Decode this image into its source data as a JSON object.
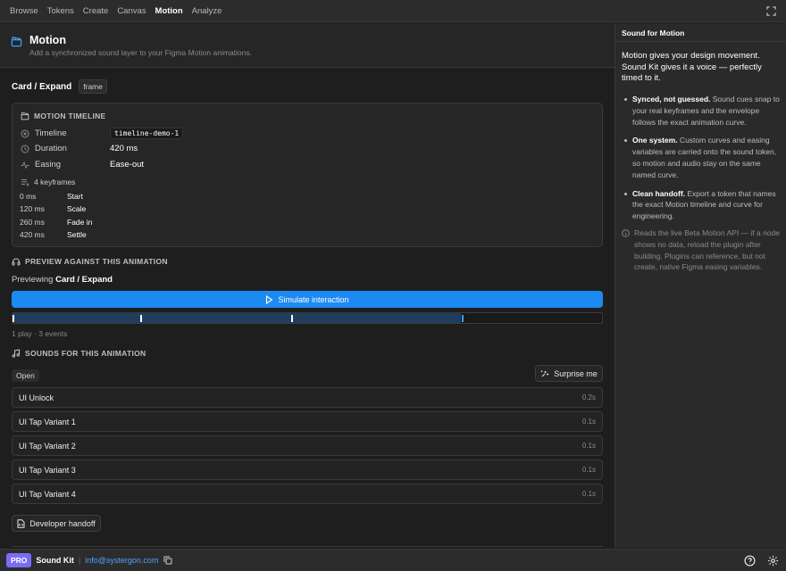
{
  "nav": {
    "tabs": [
      "Browse",
      "Tokens",
      "Create",
      "Canvas",
      "Motion",
      "Analyze"
    ],
    "active": "Motion"
  },
  "header": {
    "title": "Motion",
    "subtitle": "Add a synchronized sound layer to your Figma Motion animations."
  },
  "frame": {
    "name": "Card / Expand",
    "badge": "frame"
  },
  "timeline": {
    "section_title": "MOTION TIMELINE",
    "timeline_label": "Timeline",
    "timeline_value": "timeline-demo-1",
    "duration_label": "Duration",
    "duration_value": "420 ms",
    "easing_label": "Easing",
    "easing_value": "Ease-out",
    "keyframes_label": "4 keyframes",
    "keyframes": [
      {
        "time": "0 ms",
        "name": "Start"
      },
      {
        "time": "120 ms",
        "name": "Scale"
      },
      {
        "time": "260 ms",
        "name": "Fade in"
      },
      {
        "time": "420 ms",
        "name": "Settle"
      }
    ]
  },
  "preview": {
    "section_title": "PREVIEW AGAINST THIS ANIMATION",
    "previewing_prefix": "Previewing",
    "previewing_target": "Card / Expand",
    "simulate_label": "Simulate interaction",
    "progress_fraction": 0.76,
    "plays_text": "1 play · 3 events"
  },
  "sounds": {
    "section_title": "SOUNDS FOR THIS ANIMATION",
    "open_label": "Open",
    "surprise_label": "Surprise me",
    "items": [
      {
        "name": "UI Unlock",
        "duration": "0.2s"
      },
      {
        "name": "UI Tap Variant 1",
        "duration": "0.1s"
      },
      {
        "name": "UI Tap Variant 2",
        "duration": "0.1s"
      },
      {
        "name": "UI Tap Variant 3",
        "duration": "0.1s"
      },
      {
        "name": "UI Tap Variant 4",
        "duration": "0.1s"
      }
    ],
    "handoff_label": "Developer handoff"
  },
  "side": {
    "title": "Sound for Motion",
    "intro": "Motion gives your design movement. Sound Kit gives it a voice — perfectly timed to it.",
    "bullets": [
      {
        "bold": "Synced, not guessed.",
        "text": " Sound cues snap to your real keyframes and the envelope follows the exact animation curve."
      },
      {
        "bold": "One system.",
        "text": " Custom curves and easing variables are carried onto the sound token, so motion and audio stay on the same named curve."
      },
      {
        "bold": "Clean handoff.",
        "text": " Export a token that names the exact Motion timeline and curve for engineering."
      }
    ],
    "note": "Reads the live Beta Motion API — if a node shows no data, reload the plugin after building. Plugins can reference, but not create, native Figma easing variables."
  },
  "footer": {
    "badge": "PRO",
    "brand": "Sound Kit",
    "separator": "|",
    "email": "info@systergon.com"
  },
  "colors": {
    "accent": "#1d8af3",
    "pro": "#7b6cf6",
    "link": "#4da3ff"
  }
}
